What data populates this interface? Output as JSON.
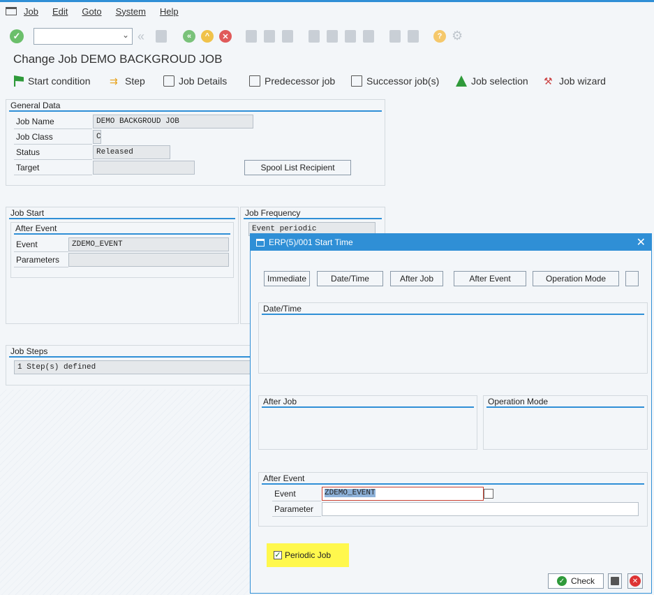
{
  "menu": [
    "Job",
    "Edit",
    "Goto",
    "System",
    "Help"
  ],
  "page_title": "Change Job DEMO BACKGROUD JOB",
  "app_toolbar": {
    "start_condition": "Start condition",
    "step": "Step",
    "job_details": "Job Details",
    "predecessor_job": "Predecessor job",
    "successor_jobs": "Successor job(s)",
    "job_selection": "Job selection",
    "job_wizard": "Job wizard"
  },
  "general_data": {
    "header": "General Data",
    "job_name_label": "Job Name",
    "job_name": "DEMO BACKGROUD JOB",
    "job_class_label": "Job Class",
    "job_class": "C",
    "status_label": "Status",
    "status": "Released",
    "target_label": "Target",
    "target": "",
    "spool_button": "Spool List Recipient"
  },
  "job_start": {
    "header": "Job Start",
    "sub_header": "After Event",
    "event_label": "Event",
    "event": "ZDEMO_EVENT",
    "parameters_label": "Parameters",
    "parameters": ""
  },
  "job_frequency": {
    "header": "Job Frequency",
    "value": "Event periodic"
  },
  "job_steps": {
    "header": "Job Steps",
    "value": "1 Step(s) defined"
  },
  "dialog": {
    "title": "ERP(5)/001 Start Time",
    "buttons": {
      "immediate": "Immediate",
      "date_time": "Date/Time",
      "after_job": "After Job",
      "after_event": "After Event",
      "operation_mode": "Operation Mode"
    },
    "date_time_header": "Date/Time",
    "after_job_header": "After Job",
    "operation_mode_header": "Operation Mode",
    "after_event_header": "After Event",
    "event_label": "Event",
    "event_value": "ZDEMO_EVENT",
    "parameter_label": "Parameter",
    "parameter_value": "",
    "periodic_job_label": "Periodic Job",
    "periodic_job_checked": true,
    "check_button": "Check"
  }
}
